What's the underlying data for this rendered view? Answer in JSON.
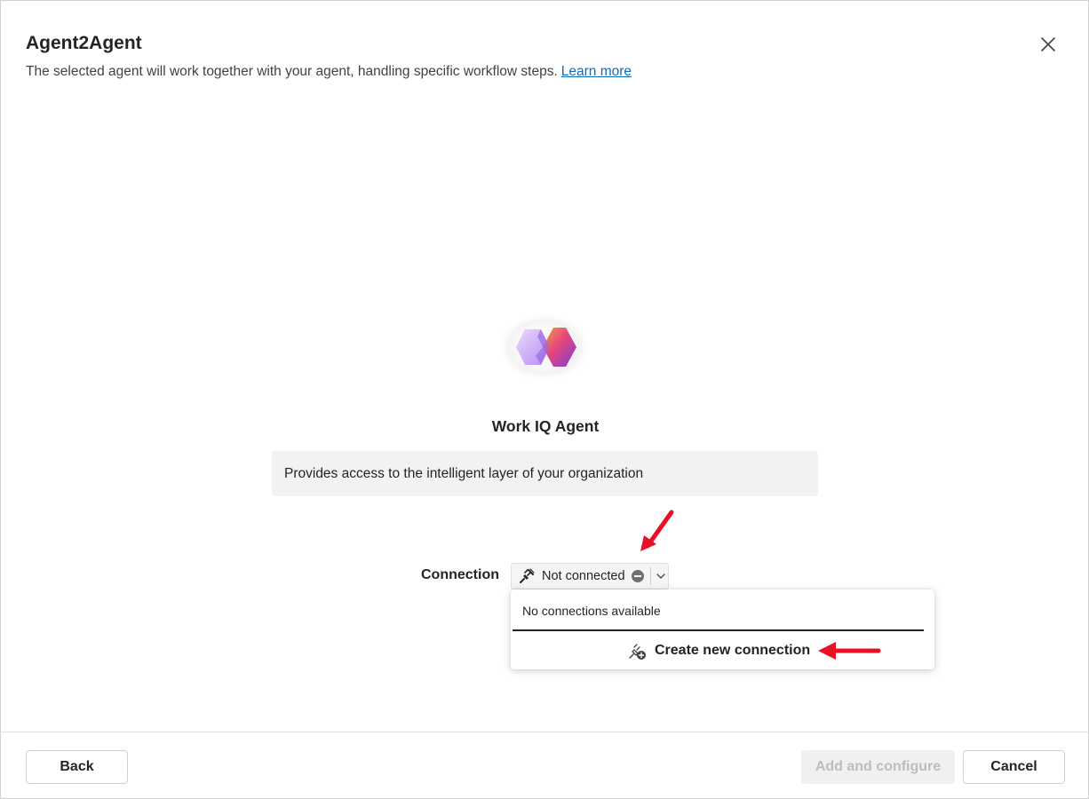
{
  "dialog": {
    "title": "Agent2Agent",
    "subtitle": "The selected agent will work together with your agent, handling specific workflow steps.",
    "learn_more": "Learn more"
  },
  "agent": {
    "name": "Work IQ Agent",
    "description": "Provides access to the intelligent layer of your organization",
    "logo_icon": "copilot-logo-icon"
  },
  "connection": {
    "label": "Connection",
    "status": "Not connected",
    "plug_icon": "plug-disconnected-icon",
    "dropdown": {
      "empty_text": "No connections available",
      "create_label": "Create new connection",
      "create_icon": "plug-add-icon"
    }
  },
  "footer": {
    "back_label": "Back",
    "add_label": "Add and configure",
    "cancel_label": "Cancel"
  },
  "colors": {
    "link": "#0f6cbd",
    "annotation_arrow": "#e81123",
    "disabled_bg": "#f0f0f0",
    "disabled_text": "#bdbdbd"
  }
}
